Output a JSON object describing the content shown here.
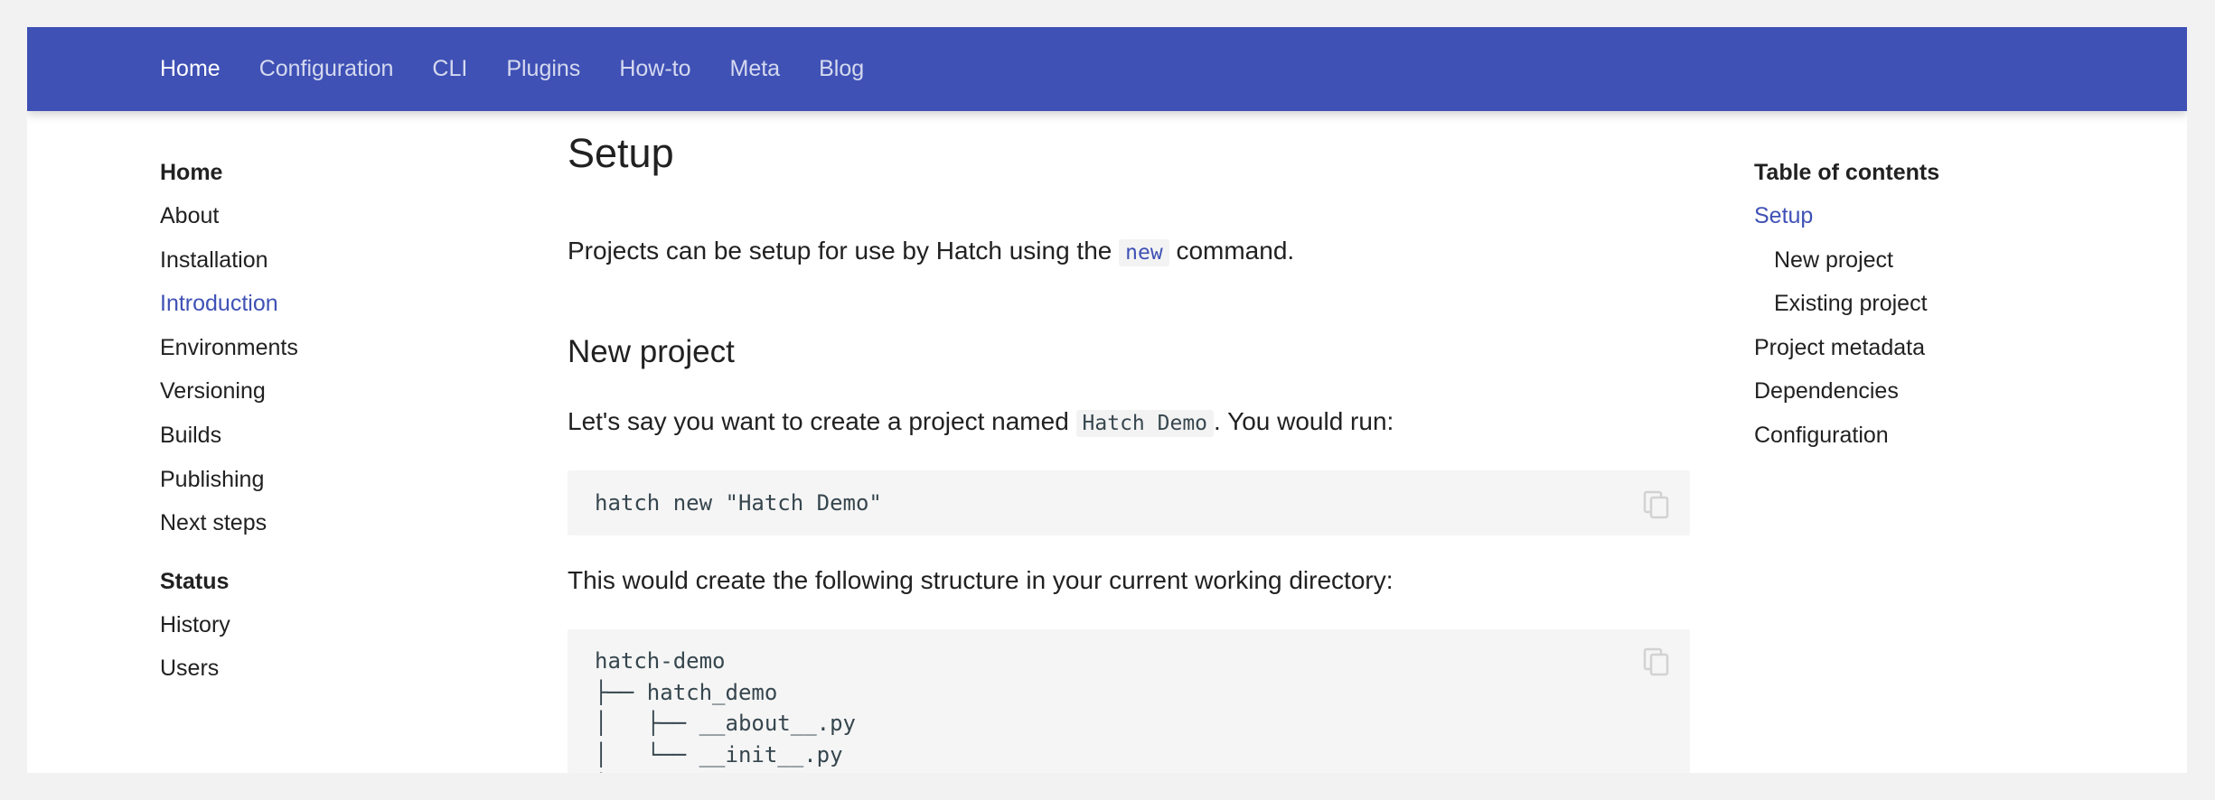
{
  "header": {
    "nav": [
      "Home",
      "Configuration",
      "CLI",
      "Plugins",
      "How-to",
      "Meta",
      "Blog"
    ]
  },
  "sidebar": {
    "section1_title": "Home",
    "section1_items": [
      "About",
      "Installation",
      "Introduction",
      "Environments",
      "Versioning",
      "Builds",
      "Publishing",
      "Next steps"
    ],
    "section2_title": "Status",
    "section2_items": [
      "History",
      "Users"
    ]
  },
  "main": {
    "title": "Setup",
    "intro_before": "Projects can be setup for use by Hatch using the ",
    "intro_code": "new",
    "intro_after": " command.",
    "new_project_heading": "New project",
    "np_before": "Let's say you want to create a project named ",
    "np_code": "Hatch Demo",
    "np_after": ". You would run:",
    "command": "hatch new \"Hatch Demo\"",
    "structure_text": "This would create the following structure in your current working directory:",
    "tree": "hatch-demo\n├── hatch_demo\n│   ├── __about__.py\n│   └── __init__.py\n├── tests"
  },
  "toc": {
    "title": "Table of contents",
    "items": [
      "Setup",
      "New project",
      "Existing project",
      "Project metadata",
      "Dependencies",
      "Configuration"
    ]
  },
  "colors": {
    "header_bg": "#3f51b5",
    "accent": "#3f51b5",
    "code_bg": "#f5f5f5",
    "page_bg": "#f2f2f2"
  },
  "icons": {
    "copy": "copy-icon"
  }
}
